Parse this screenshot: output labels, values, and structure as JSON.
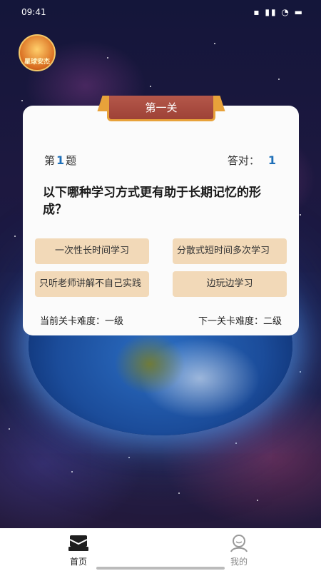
{
  "status_bar": {
    "time": "09:41",
    "icons": "▪ ▮▮ ◔ ▬"
  },
  "header": {
    "logo_text": "星球安杰",
    "app_name": ""
  },
  "card": {
    "banner_title": "第一关",
    "question_prefix": "第",
    "question_number": "1",
    "question_suffix": "题",
    "correct_label": "答对：",
    "correct_count": "1",
    "question_text": "以下哪种学习方式更有助于长期记忆的形成？",
    "options": [
      "一次性长时间学习",
      "分散式短时间多次学习",
      "只听老师讲解不自己实践",
      "边玩边学习"
    ],
    "current_level": "当前关卡难度：一级",
    "next_level": "下一关卡难度：二级"
  },
  "tabbar": {
    "items": [
      {
        "label": "首页",
        "icon": "home-icon",
        "active": true
      },
      {
        "label": "我的",
        "icon": "user-icon",
        "active": false
      }
    ]
  }
}
